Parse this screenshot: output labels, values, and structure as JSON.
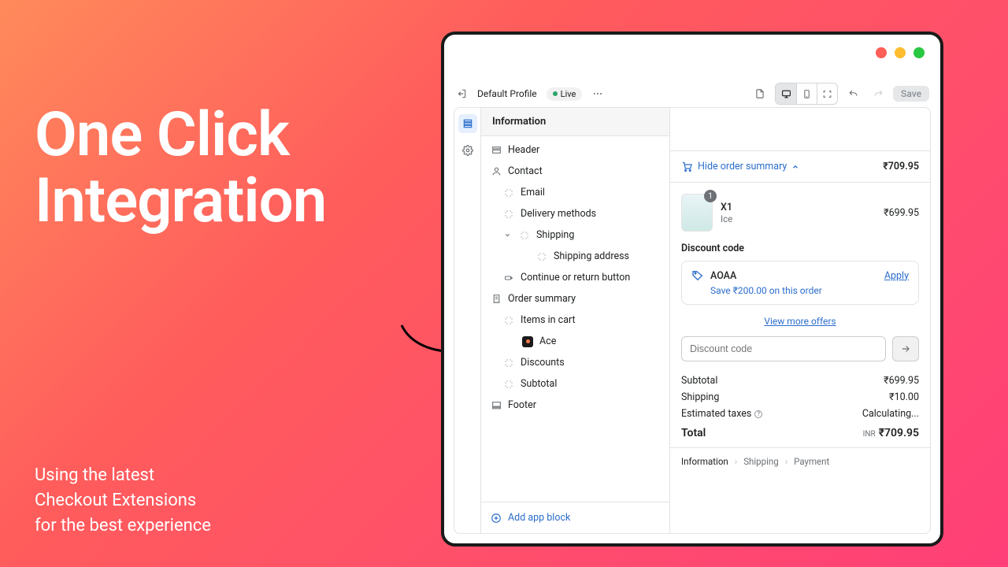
{
  "hero": {
    "line1": "One Click",
    "line2": "Integration"
  },
  "sub": {
    "l1": "Using the latest",
    "l2": "Checkout Extensions",
    "l3": "for the best experience"
  },
  "topbar": {
    "profile": "Default Profile",
    "live": "Live",
    "save": "Save"
  },
  "panel": {
    "title": "Information",
    "header": "Header",
    "contact": "Contact",
    "email": "Email",
    "delivery": "Delivery methods",
    "shipping": "Shipping",
    "shipping_address": "Shipping address",
    "continue": "Continue or return button",
    "order_summary": "Order summary",
    "items_in_cart": "Items in cart",
    "ace": "Ace",
    "discounts": "Discounts",
    "subtotal": "Subtotal",
    "footer": "Footer",
    "add_block": "Add app block"
  },
  "preview": {
    "toggle": "Hide order summary",
    "toggle_price": "₹709.95",
    "qty": "1",
    "product": "X1",
    "variant": "Ice",
    "product_price": "₹699.95",
    "discount_title": "Discount code",
    "code": "AOAA",
    "apply": "Apply",
    "save_msg": "Save ₹200.00 on this order",
    "view_more": "View more offers",
    "placeholder": "Discount code",
    "subtotal_label": "Subtotal",
    "subtotal_value": "₹699.95",
    "shipping_label": "Shipping",
    "shipping_value": "₹10.00",
    "tax_label": "Estimated taxes",
    "tax_value": "Calculating...",
    "total_label": "Total",
    "currency": "INR",
    "total_value": "₹709.95",
    "bc1": "Information",
    "bc2": "Shipping",
    "bc3": "Payment"
  }
}
